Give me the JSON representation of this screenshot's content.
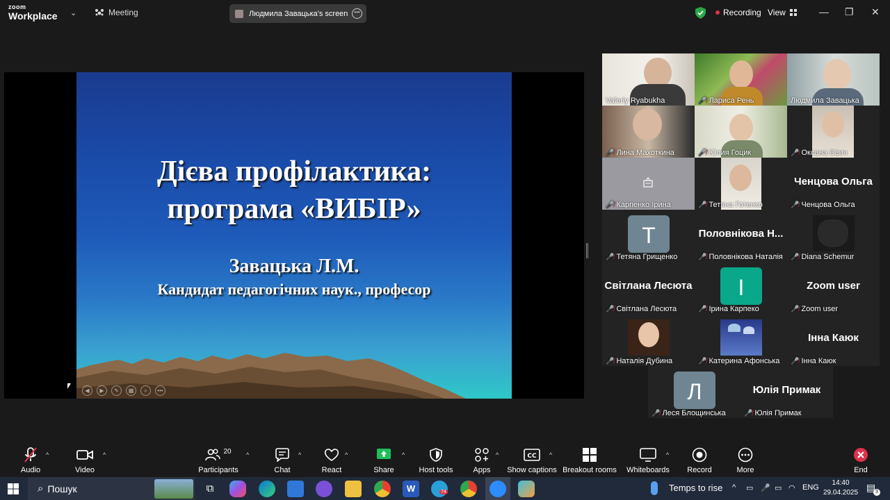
{
  "app": {
    "logo_top": "zoom",
    "logo_bottom": "Workplace",
    "meeting_label": "Meeting",
    "screen_share_label": "Людмила Завацька's screen",
    "recording_label": "Recording",
    "view_label": "View"
  },
  "slide": {
    "title_line1": "Дієва профілактика:",
    "title_line2": "програма «ВИБІР»",
    "author": "Завацька Л.М.",
    "subtitle": "Кандидат педагогічних наук., професор"
  },
  "participants": [
    {
      "name": "Valeriy Ryabukha",
      "muted": false
    },
    {
      "name": "Лариса Рень",
      "muted": true
    },
    {
      "name": "Людмила Завацька",
      "muted": false,
      "active": true
    },
    {
      "name": "Лина Махоткина",
      "muted": true
    },
    {
      "name": "Юлия Гоцик",
      "muted": true
    },
    {
      "name": "Оксана Євич",
      "muted": true
    },
    {
      "name": "Карпенко Ірина",
      "muted": true
    },
    {
      "name": "Тетяна Готенко",
      "muted": true
    },
    {
      "name": "Ченцова Ольга",
      "muted": true,
      "big_label": "Ченцова Ольга"
    },
    {
      "name": "Тетяна Грищенко",
      "muted": true,
      "avatar": "T"
    },
    {
      "name": "Половнікова Наталія",
      "muted": true,
      "big_label": "Половнікова Н..."
    },
    {
      "name": "Diana Schemur",
      "muted": true
    },
    {
      "name": "Світлана Лесюта",
      "muted": true,
      "big_label": "Світлана Лесюта"
    },
    {
      "name": "Ірина Карпеко",
      "muted": true,
      "avatar": "І"
    },
    {
      "name": "Zoom user",
      "muted": true,
      "big_label": "Zoom user"
    },
    {
      "name": "Наталія Дубина",
      "muted": true
    },
    {
      "name": "Катерина Афонська",
      "muted": true
    },
    {
      "name": "Інна Каюк",
      "muted": true,
      "big_label": "Інна Каюк"
    },
    {
      "name": "Леся Блощинська",
      "muted": true,
      "avatar": "Л"
    },
    {
      "name": "Юлія Примак",
      "muted": true,
      "big_label": "Юлія Примак"
    }
  ],
  "toolbar": {
    "audio": "Audio",
    "video": "Video",
    "participants": "Participants",
    "participants_count": "20",
    "chat": "Chat",
    "react": "React",
    "share": "Share",
    "host_tools": "Host tools",
    "apps": "Apps",
    "show_captions": "Show captions",
    "breakout_rooms": "Breakout rooms",
    "whiteboards": "Whiteboards",
    "record": "Record",
    "more": "More",
    "end": "End"
  },
  "taskbar": {
    "search_placeholder": "Пошук",
    "weather": "Temps to rise",
    "language": "ENG",
    "time": "14:40",
    "date": "29.04.2025",
    "notifications": "3",
    "telegram_badge": "74"
  },
  "colors": {
    "accent_green": "#4fd47b",
    "muted_red": "#e0314b",
    "share_green": "#1fbf5a",
    "end_red": "#e0314b"
  }
}
